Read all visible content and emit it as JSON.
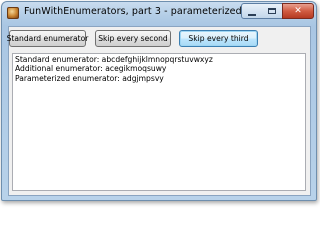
{
  "window": {
    "title": "FunWithEnumerators, part 3 - parameterized enumerators"
  },
  "toolbar": {
    "standard_label": "Standard enumerator",
    "skip_second_label": "Skip every second",
    "skip_third_label": "Skip every third"
  },
  "output": {
    "lines": [
      "Standard enumerator: abcdefghijklmnopqrstuvwxyz",
      "Additional enumerator: acegikmoqsuwy",
      "Parameterized enumerator: adgjmpsvy"
    ]
  },
  "icons": {
    "app": "app-icon",
    "minimize": "minimize-icon",
    "maximize": "maximize-icon",
    "close": "close-icon"
  },
  "colors": {
    "title_bar": "#b3cde6",
    "close_button": "#d15c42",
    "focused_button_border": "#3c7fb1"
  }
}
